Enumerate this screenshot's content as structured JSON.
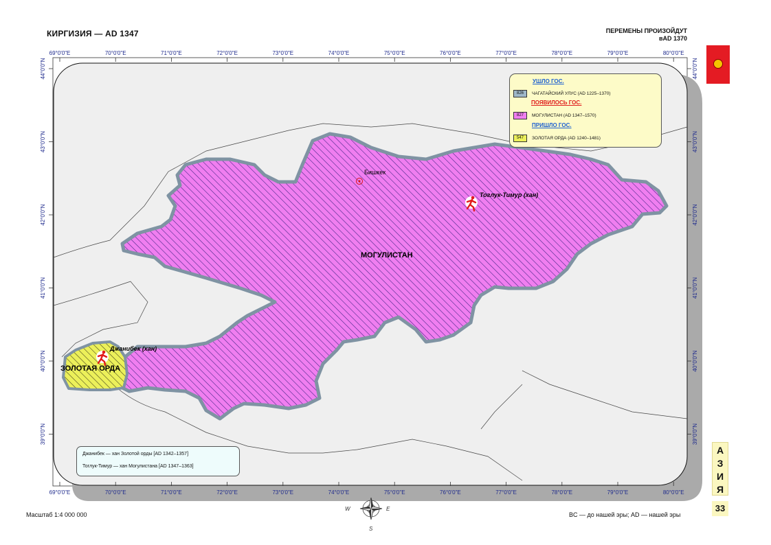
{
  "page": {
    "title": "КИРГИЗИЯ — AD 1347",
    "changes_line1": "ПЕРЕМЕНЫ ПРОИЗОЙДУТ",
    "changes_line2": "вAD 1370",
    "scale": "Масштаб 1:4 000 000",
    "era_note": "BC — до нашей эры; AD — нашей эры",
    "section_letters": [
      "А",
      "З",
      "И",
      "Я"
    ],
    "page_number": "33",
    "flag_color": "#e41b23"
  },
  "graticule": {
    "lon_labels": [
      "69°0'0\"E",
      "70°0'0\"E",
      "71°0'0\"E",
      "72°0'0\"E",
      "73°0'0\"E",
      "74°0'0\"E",
      "75°0'0\"E",
      "76°0'0\"E",
      "77°0'0\"E",
      "78°0'0\"E",
      "79°0'0\"E",
      "80°0'0\"E"
    ],
    "lat_labels": [
      "44°0'0\"N",
      "43°0'0\"N",
      "42°0'0\"N",
      "41°0'0\"N",
      "40°0'0\"N",
      "39°0'0\"N"
    ]
  },
  "legend": {
    "gone_heading": "УШЛО ГОС.",
    "gone_item": {
      "code": "826",
      "label": "ЧАГАТАЙСКИЙ УЛУС (AD 1225–1370)",
      "color": "#9fb8c9"
    },
    "appeared_heading": "ПОЯВИЛОСЬ ГОС.",
    "appeared_item": {
      "code": "827",
      "label": "МОГУЛИСТАН (AD 1347–1570)",
      "color": "#f07ef0"
    },
    "came_heading": "ПРИШЛО ГОС.",
    "came_item": {
      "code": "547",
      "label": "ЗОЛОТАЯ ОРДА (AD 1240–1481)",
      "color": "#ecf05a"
    },
    "gone_color": "#1b5fd0",
    "appeared_color": "#e01b1b",
    "came_color": "#1b5fd0"
  },
  "map": {
    "region_main": "МОГУЛИСТАН",
    "region_west": "ЗОЛОТАЯ ОРДА",
    "city": "Бишкек",
    "ruler_east": "Тоглук-Тимур (хан)",
    "ruler_west": "Джанибек (хан)",
    "main_color": "#f07ef0",
    "west_color": "#ecf05a",
    "border_color": "#7f93a3"
  },
  "notes": {
    "line1": "Джанибек — хан Золотой орды [AD 1342–1357]",
    "line2": "Тоглук-Тимур — хан Могулистана [AD 1347–1363]"
  }
}
